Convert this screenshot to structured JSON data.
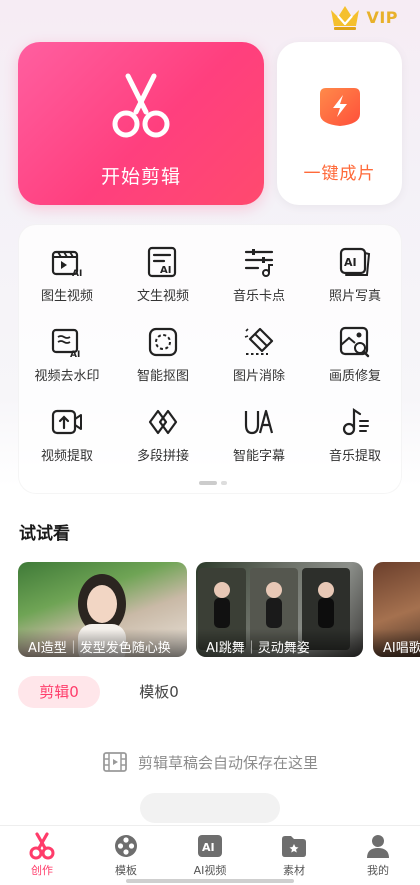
{
  "vip": {
    "label": "VIP"
  },
  "hero": {
    "edit_label": "开始剪辑",
    "oneclick_label": "一键成片"
  },
  "tools": [
    {
      "label": "图生视频",
      "icon": "image-to-video-icon"
    },
    {
      "label": "文生视频",
      "icon": "text-to-video-icon"
    },
    {
      "label": "音乐卡点",
      "icon": "music-beat-icon"
    },
    {
      "label": "照片写真",
      "icon": "photo-portrait-icon"
    },
    {
      "label": "视频去水印",
      "icon": "remove-watermark-icon"
    },
    {
      "label": "智能抠图",
      "icon": "smart-cutout-icon"
    },
    {
      "label": "图片消除",
      "icon": "eraser-icon"
    },
    {
      "label": "画质修复",
      "icon": "quality-repair-icon"
    },
    {
      "label": "视频提取",
      "icon": "video-extract-icon"
    },
    {
      "label": "多段拼接",
      "icon": "multi-splice-icon"
    },
    {
      "label": "智能字幕",
      "icon": "smart-subtitle-icon"
    },
    {
      "label": "音乐提取",
      "icon": "music-extract-icon"
    }
  ],
  "try": {
    "title": "试试看",
    "cards": [
      {
        "caption": "AI造型｜发型发色随心换"
      },
      {
        "caption": "AI跳舞｜灵动舞姿"
      },
      {
        "caption": "AI唱歌"
      }
    ]
  },
  "tabs": {
    "edit": "剪辑0",
    "template": "模板0"
  },
  "empty_text": "剪辑草稿会自动保存在这里",
  "nav": [
    {
      "label": "创作",
      "icon": "create-icon"
    },
    {
      "label": "模板",
      "icon": "template-icon"
    },
    {
      "label": "AI视频",
      "icon": "ai-video-icon"
    },
    {
      "label": "素材",
      "icon": "material-icon"
    },
    {
      "label": "我的",
      "icon": "profile-icon"
    }
  ],
  "colors": {
    "accent": "#ff3c6a",
    "vip_gold": "#e8b12a",
    "oneclick_orange": "#ff6a3a"
  }
}
